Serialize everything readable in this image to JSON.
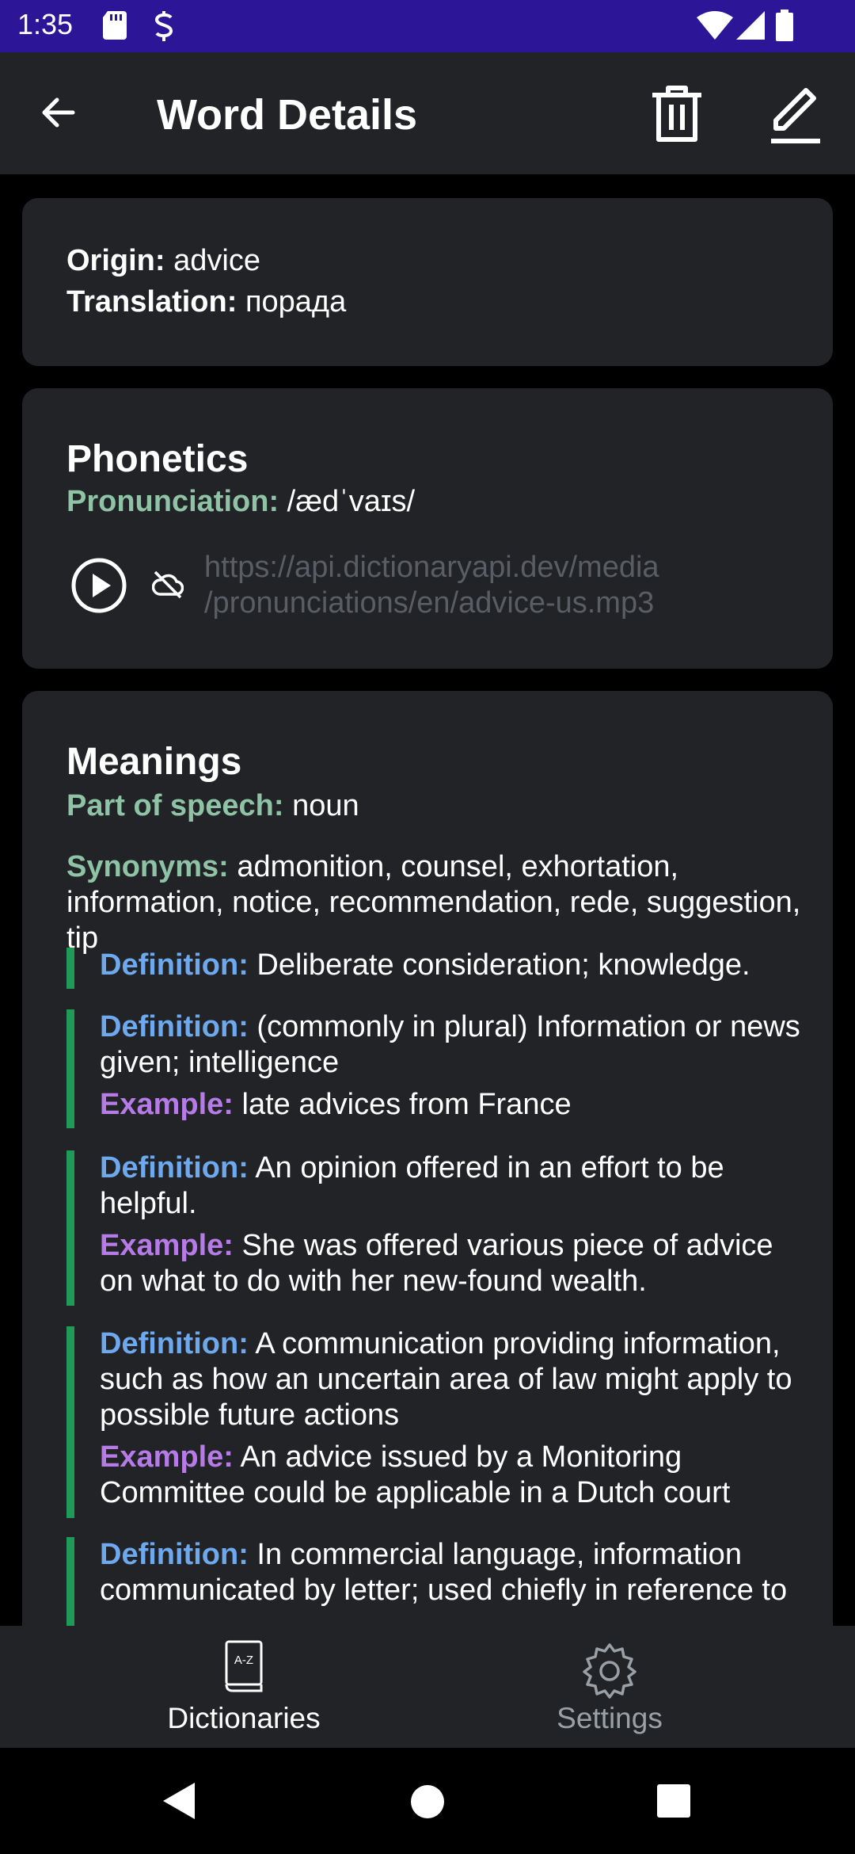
{
  "status_bar": {
    "time": "1:35"
  },
  "app_bar": {
    "title": "Word Details"
  },
  "origin_card": {
    "origin_label": "Origin:",
    "origin_value": "advice",
    "translation_label": "Translation:",
    "translation_value": "порада"
  },
  "phonetics": {
    "heading": "Phonetics",
    "pronunciation_label": "Pronunciation:",
    "pronunciation_value": "/ædˈvaɪs/",
    "audio_url_line1": "https://api.dictionaryapi.dev/media",
    "audio_url_line2": "/pronunciations/en/advice-us.mp3"
  },
  "meanings": {
    "heading": "Meanings",
    "pos_label": "Part of speech:",
    "pos_value": "noun",
    "synonyms_label": "Synonyms:",
    "synonyms_value": "admonition, counsel, exhortation, information, notice, recommendation, rede, suggestion, tip",
    "definition_label": "Definition:",
    "example_label": "Example:",
    "definitions": [
      {
        "definition": "Deliberate consideration; knowledge."
      },
      {
        "definition": "(commonly in plural) Information or news given; intelligence",
        "example": "late advices from France"
      },
      {
        "definition": "An opinion offered in an effort to be helpful.",
        "example": "She was offered various piece of advice on what to do with her new-found wealth."
      },
      {
        "definition": "A communication providing information, such as how an uncertain area of law might apply to possible future actions",
        "example": "An advice issued by a Monitoring Committee could be applicable in a Dutch court"
      },
      {
        "definition": "In commercial language, information communicated by letter; used chiefly in reference to"
      }
    ]
  },
  "bottom_nav": {
    "items": [
      {
        "label": "Dictionaries",
        "icon": "dictionary-az-icon",
        "active": true
      },
      {
        "label": "Settings",
        "icon": "gear-icon",
        "active": false
      }
    ]
  },
  "colors": {
    "status_bar": "#2d1597",
    "surface": "#212327",
    "green_label": "#8fc3a6",
    "blue_label": "#6ea9ee",
    "purple_label": "#b77be7",
    "accent_bar": "#1f9a57"
  }
}
